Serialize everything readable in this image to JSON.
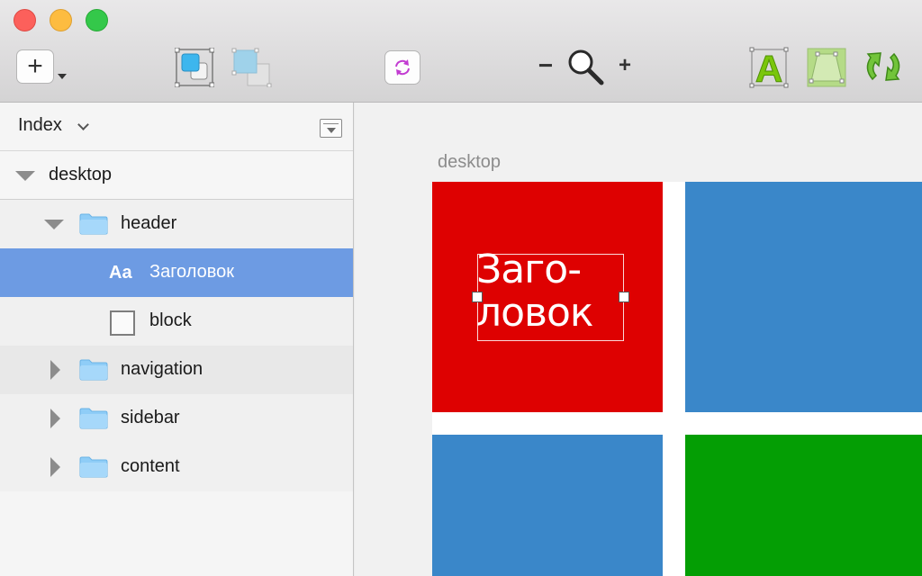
{
  "toolbar": {
    "add_label": "+",
    "zoom_out_label": "−",
    "zoom_in_label": "+",
    "text_icon_letter": "A"
  },
  "sidebar": {
    "title": "Index",
    "tree": {
      "desktop": "desktop",
      "header": "header",
      "heading_layer_prefix": "Aa",
      "heading_layer": "Заголовок",
      "block": "block",
      "navigation": "navigation",
      "sidebar": "sidebar",
      "content": "content"
    }
  },
  "canvas": {
    "artboard_title": "desktop",
    "heading_text": "Заго-\nловок"
  },
  "colors": {
    "tile_red": "#de0101",
    "tile_blue": "#3a87c9",
    "tile_green": "#049e04",
    "selection": "#6d9be3"
  }
}
